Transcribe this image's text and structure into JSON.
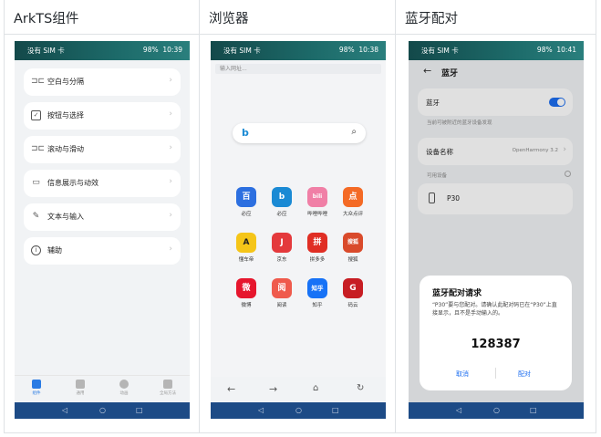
{
  "columns": [
    {
      "header": "ArkTS组件"
    },
    {
      "header": "浏览器"
    },
    {
      "header": "蓝牙配对"
    }
  ],
  "status": {
    "carrier": "没有 SIM 卡",
    "battery": "98%",
    "times": [
      "10:39",
      "10:38",
      "10:41"
    ]
  },
  "arkts": {
    "items": [
      {
        "label": "空白与分隔",
        "icon": "divider-icon"
      },
      {
        "label": "按钮与选择",
        "icon": "checkbox-icon"
      },
      {
        "label": "滚动与滑动",
        "icon": "scroll-icon"
      },
      {
        "label": "信息展示与动效",
        "icon": "chat-bubble-icon"
      },
      {
        "label": "文本与输入",
        "icon": "edit-icon"
      },
      {
        "label": "辅助",
        "icon": "info-icon"
      }
    ],
    "tabs": [
      "组件",
      "通用",
      "动画",
      "全局方法"
    ]
  },
  "browser": {
    "address_placeholder": "输入网址...",
    "apps": [
      {
        "label": "必应",
        "glyph": "百",
        "color": "#2c6fe0"
      },
      {
        "label": "必应",
        "glyph": "b",
        "color": "#1a8ad4"
      },
      {
        "label": "哔哩哔哩",
        "glyph": "bili",
        "color": "#f07fa6"
      },
      {
        "label": "大众点评",
        "glyph": "点",
        "color": "#f46a25"
      },
      {
        "label": "懂车帝",
        "glyph": "A",
        "color": "#f5c518"
      },
      {
        "label": "京东",
        "glyph": "J",
        "color": "#e4393c"
      },
      {
        "label": "拼多多",
        "glyph": "拼",
        "color": "#e02e24"
      },
      {
        "label": "搜狐",
        "glyph": "搜狐",
        "color": "#d94a2b"
      },
      {
        "label": "微博",
        "glyph": "微",
        "color": "#e6162d"
      },
      {
        "label": "阅读",
        "glyph": "阅",
        "color": "#ef5a4c"
      },
      {
        "label": "知乎",
        "glyph": "知乎",
        "color": "#1772f6"
      },
      {
        "label": "码云",
        "glyph": "G",
        "color": "#c71d23"
      }
    ]
  },
  "bluetooth": {
    "title": "蓝牙",
    "toggle_label": "蓝牙",
    "toggle_on": true,
    "discoverable_text": "当前可被附近的蓝牙设备发现",
    "device_name_label": "设备名称",
    "device_name_value": "OpenHarmony 3.2",
    "available_label": "可用设备",
    "device": "P30",
    "dialog": {
      "title": "蓝牙配对请求",
      "message": "“P30”要与您配对。请确认此配对码已在“P30”上直接显示，且不是手动输入的。",
      "code": "128387",
      "cancel": "取消",
      "confirm": "配对"
    }
  },
  "colors": {
    "accent": "#1d6ef0",
    "navbar": "#1d4b86",
    "status": "#1d6b6a"
  }
}
